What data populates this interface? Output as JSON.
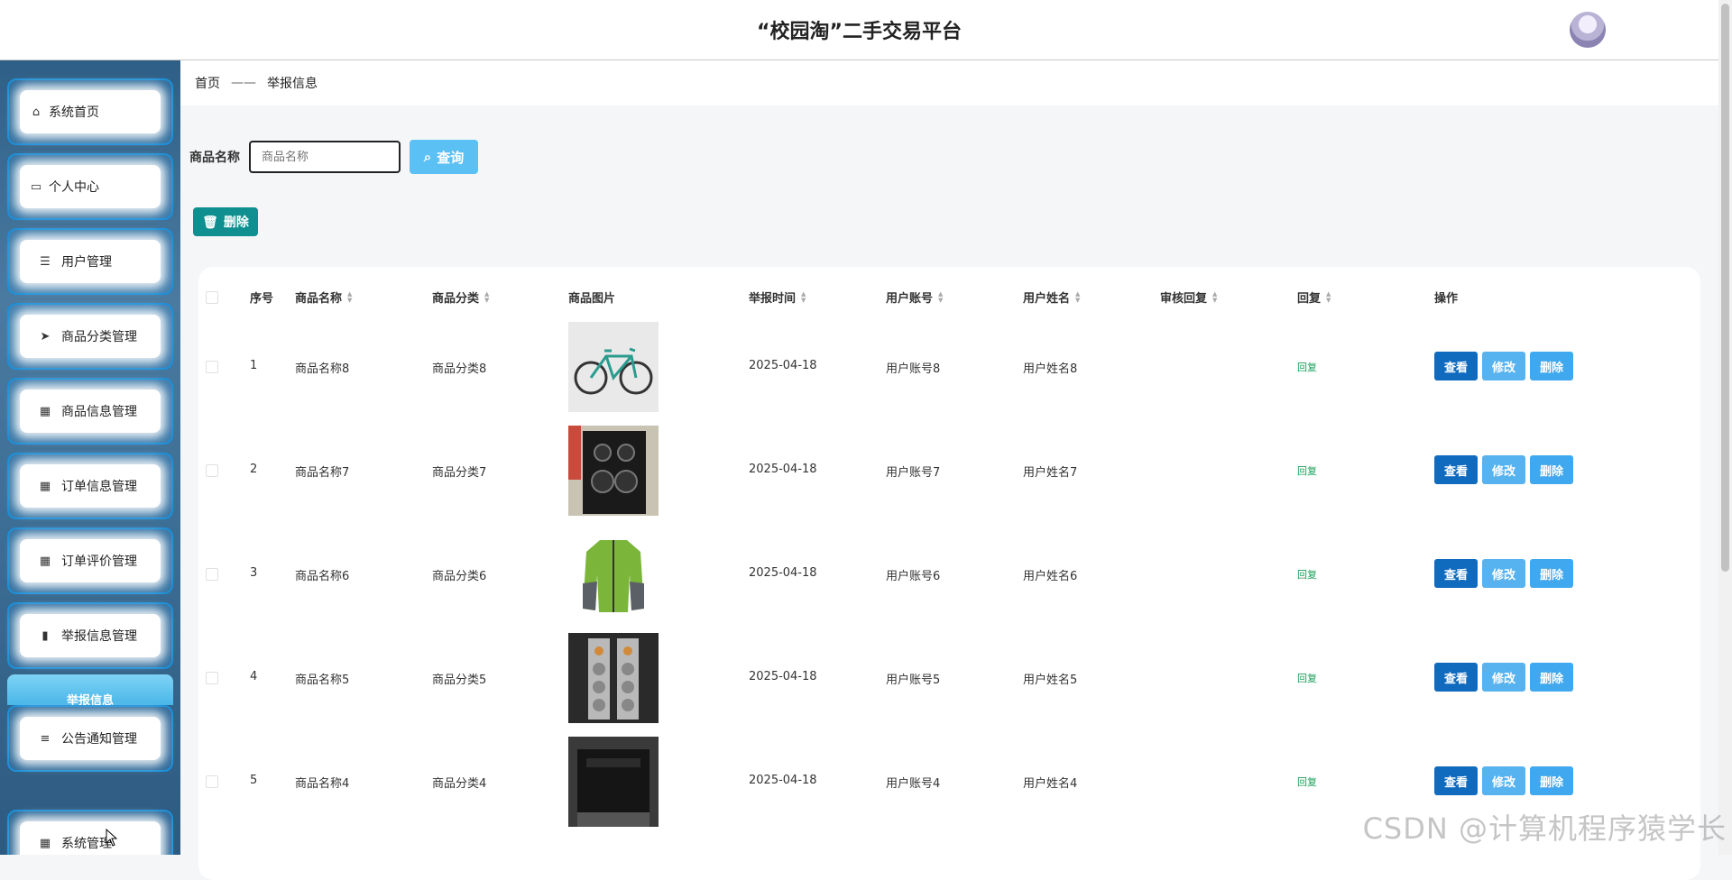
{
  "header": {
    "title": "“校园淘”二手交易平台"
  },
  "sidebar": {
    "items": [
      {
        "label": "系统首页",
        "icon": "home-icon"
      },
      {
        "label": "个人中心",
        "icon": "card-icon"
      },
      {
        "label": "用户管理",
        "icon": "list-icon"
      },
      {
        "label": "商品分类管理",
        "icon": "send-icon"
      },
      {
        "label": "商品信息管理",
        "icon": "grid-icon"
      },
      {
        "label": "订单信息管理",
        "icon": "grid-icon"
      },
      {
        "label": "订单评价管理",
        "icon": "grid-icon"
      },
      {
        "label": "举报信息管理",
        "icon": "chart-icon"
      },
      {
        "label": "公告通知管理",
        "icon": "menu-icon"
      },
      {
        "label": "系统管理",
        "icon": "apps-icon"
      }
    ],
    "submenu_label": "举报信息"
  },
  "breadcrumb": {
    "home": "首页",
    "separator": "——",
    "current": "举报信息"
  },
  "search": {
    "label": "商品名称",
    "placeholder": "商品名称",
    "button": "查询"
  },
  "toolbar": {
    "delete": "删除"
  },
  "table": {
    "headers": [
      "序号",
      "商品名称",
      "商品分类",
      "商品图片",
      "举报时间",
      "用户账号",
      "用户姓名",
      "审核回复",
      "回复",
      "操作"
    ],
    "rows": [
      {
        "index": "1",
        "name": "商品名称8",
        "category": "商品分类8",
        "time": "2025-04-18",
        "account": "用户账号8",
        "username": "用户姓名8",
        "audit": "",
        "reply": "回复",
        "image": "bicycle"
      },
      {
        "index": "2",
        "name": "商品名称7",
        "category": "商品分类7",
        "time": "2025-04-18",
        "account": "用户账号7",
        "username": "用户姓名7",
        "audit": "",
        "reply": "回复",
        "image": "speaker"
      },
      {
        "index": "3",
        "name": "商品名称6",
        "category": "商品分类6",
        "time": "2025-04-18",
        "account": "用户账号6",
        "username": "用户姓名6",
        "audit": "",
        "reply": "回复",
        "image": "jacket"
      },
      {
        "index": "4",
        "name": "商品名称5",
        "category": "商品分类5",
        "time": "2025-04-18",
        "account": "用户账号5",
        "username": "用户姓名5",
        "audit": "",
        "reply": "回复",
        "image": "tower-speakers"
      },
      {
        "index": "5",
        "name": "商品名称4",
        "category": "商品分类4",
        "time": "2025-04-18",
        "account": "用户账号4",
        "username": "用户姓名4",
        "audit": "",
        "reply": "回复",
        "image": "box-speaker"
      }
    ],
    "actions": {
      "view": "查看",
      "edit": "修改",
      "delete": "删除"
    }
  },
  "watermark": "CSDN @计算机程序猿学长",
  "colors": {
    "primary": "#106bbf",
    "accent": "#5bc0f3",
    "teal": "#0f8f8f",
    "reply": "#18a058"
  }
}
